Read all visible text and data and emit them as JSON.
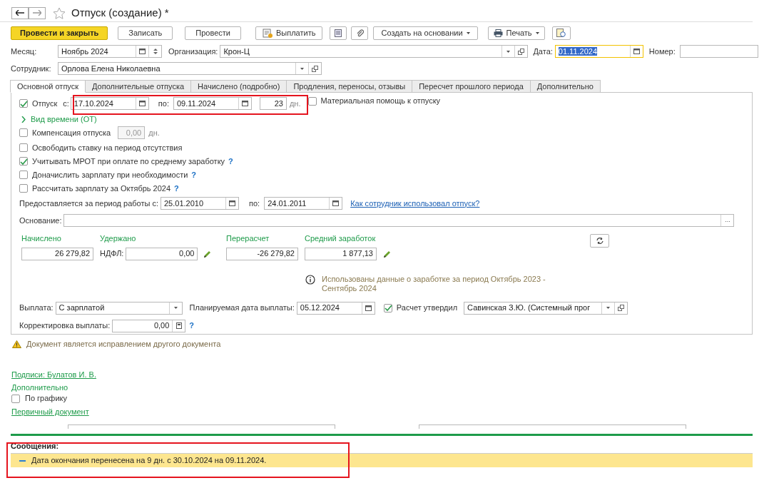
{
  "window": {
    "title": "Отпуск (создание) *"
  },
  "toolbar": [
    {
      "kind": "primary",
      "label": "Провести и закрыть"
    },
    {
      "kind": "text",
      "label": "Записать"
    },
    {
      "kind": "text",
      "label": "Провести"
    },
    {
      "kind": "pay",
      "label": "Выплатить"
    },
    {
      "kind": "list"
    },
    {
      "kind": "clip"
    },
    {
      "kind": "menu",
      "label": "Создать на основании"
    },
    {
      "kind": "print",
      "label": "Печать"
    },
    {
      "kind": "report"
    }
  ],
  "header": {
    "month_label": "Месяц:",
    "month": "Ноябрь 2024",
    "org_label": "Организация:",
    "org": "Крон-Ц",
    "date_label": "Дата:",
    "date": "01.11.2024",
    "number_label": "Номер:",
    "employee_label": "Сотрудник:",
    "employee": "Орлова Елена Николаевна"
  },
  "tabs": [
    {
      "label": "Основной отпуск",
      "selected": true
    },
    {
      "label": "Дополнительные отпуска",
      "selected": false
    },
    {
      "label": "Начислено (подробно)",
      "selected": false
    },
    {
      "label": "Продления, переносы, отзывы",
      "selected": false
    },
    {
      "label": "Пересчет прошлого периода",
      "selected": false
    },
    {
      "label": "Дополнительно",
      "selected": false
    }
  ],
  "vacation": {
    "checked": true,
    "label": "Отпуск",
    "from_label": "с:",
    "from": "17.10.2024",
    "to_label": "по:",
    "to": "09.11.2024",
    "days": "23",
    "days_unit": "дн.",
    "aid_checked": false,
    "aid_label": "Материальная помощь к отпуску"
  },
  "time_kind": {
    "label": "Вид времени (ОТ)",
    "expanded": false
  },
  "compensation": {
    "checked": false,
    "label": "Компенсация отпуска",
    "value": "0,00",
    "disabled": true,
    "unit": "дн."
  },
  "options": [
    {
      "label": "Освободить ставку на период отсутствия",
      "checked": false,
      "help": false
    },
    {
      "label": "Учитывать МРОТ при оплате по среднему заработку",
      "checked": true,
      "help": true
    },
    {
      "label": "Доначислить зарплату при необходимости",
      "checked": false,
      "help": true
    },
    {
      "label": "Рассчитать зарплату за Октябрь 2024",
      "checked": false,
      "help": true
    }
  ],
  "help_mark": "?",
  "period": {
    "label": "Предоставляется за период работы с:",
    "from": "25.01.2010",
    "to_label": "по:",
    "to": "24.01.2011",
    "link": "Как сотрудник использовал отпуск?"
  },
  "basis": {
    "label": "Основание:",
    "button": "..."
  },
  "totals": {
    "accrued_label": "Начислено",
    "accrued": "26 279,82",
    "withheld_label": "Удержано",
    "ndfl_label": "НДФЛ:",
    "ndfl": "0,00",
    "recalc_label": "Перерасчет",
    "recalc": "-26 279,82",
    "avg_label": "Средний заработок",
    "avg": "1 877,13"
  },
  "info": "Использованы данные о заработке за период Октябрь 2023 - Сентябрь 2024",
  "payment": {
    "label": "Выплата:",
    "value": "С зарплатой",
    "date_label": "Планируемая дата выплаты:",
    "date": "05.12.2024",
    "approved": true,
    "approved_label": "Расчет утвердил",
    "approver": "Савинская З.Ю. (Системный прог",
    "correction_label": "Корректировка выплаты:",
    "correction": "0,00"
  },
  "warning": "Документ является исправлением другого документа",
  "signatures": "Подписи: Булатов И. В.",
  "extra_title": "Дополнительно",
  "schedule": {
    "label": "По графику",
    "checked": false
  },
  "primary_doc": "Первичный документ",
  "messages": {
    "title": "Сообщения:",
    "items": [
      "Дата окончания перенесена на 9 дн. с 30.10.2024 на 09.11.2024."
    ]
  },
  "annotations": [
    {
      "kind": "frame"
    },
    {
      "kind": "frame"
    }
  ]
}
